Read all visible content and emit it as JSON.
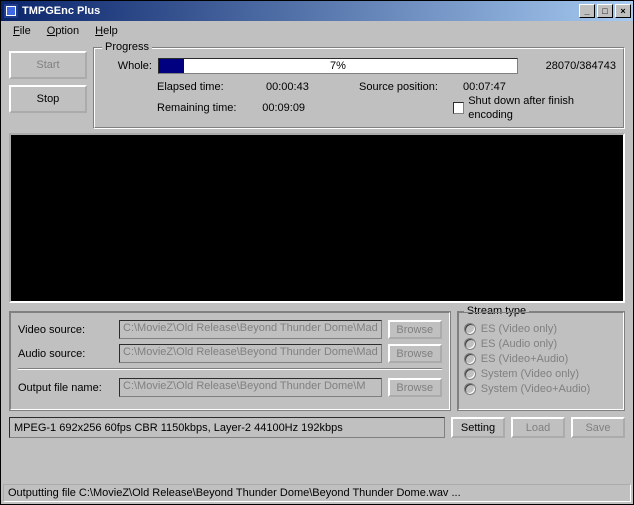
{
  "title": "TMPGEnc Plus",
  "menu": {
    "file": "File",
    "option": "Option",
    "help": "Help"
  },
  "buttons": {
    "start": "Start",
    "stop": "Stop"
  },
  "progress": {
    "groupTitle": "Progress",
    "wholeLabel": "Whole:",
    "percent": 7,
    "percentText": "7%",
    "count": "28070/384743",
    "elapsedLabel": "Elapsed time:",
    "elapsedVal": "00:00:43",
    "remainingLabel": "Remaining time:",
    "remainingVal": "00:09:09",
    "srcPosLabel": "Source position:",
    "srcPosVal": "00:07:47",
    "shutdownLabel": "Shut down after finish encoding"
  },
  "sources": {
    "videoLabel": "Video source:",
    "videoVal": "C:\\MovieZ\\Old Release\\Beyond Thunder Dome\\Mad",
    "audioLabel": "Audio source:",
    "audioVal": "C:\\MovieZ\\Old Release\\Beyond Thunder Dome\\Mad",
    "outputLabel": "Output file name:",
    "outputVal": "C:\\MovieZ\\Old Release\\Beyond Thunder Dome\\M",
    "browse": "Browse"
  },
  "stream": {
    "title": "Stream type",
    "opts": [
      "ES (Video only)",
      "ES (Audio only)",
      "ES (Video+Audio)",
      "System (Video only)",
      "System (Video+Audio)"
    ]
  },
  "format": "MPEG-1 692x256 60fps CBR 1150kbps,  Layer-2 44100Hz 192kbps",
  "footer": {
    "setting": "Setting",
    "load": "Load",
    "save": "Save"
  },
  "status": "Outputting file C:\\MovieZ\\Old Release\\Beyond Thunder Dome\\Beyond Thunder Dome.wav ..."
}
